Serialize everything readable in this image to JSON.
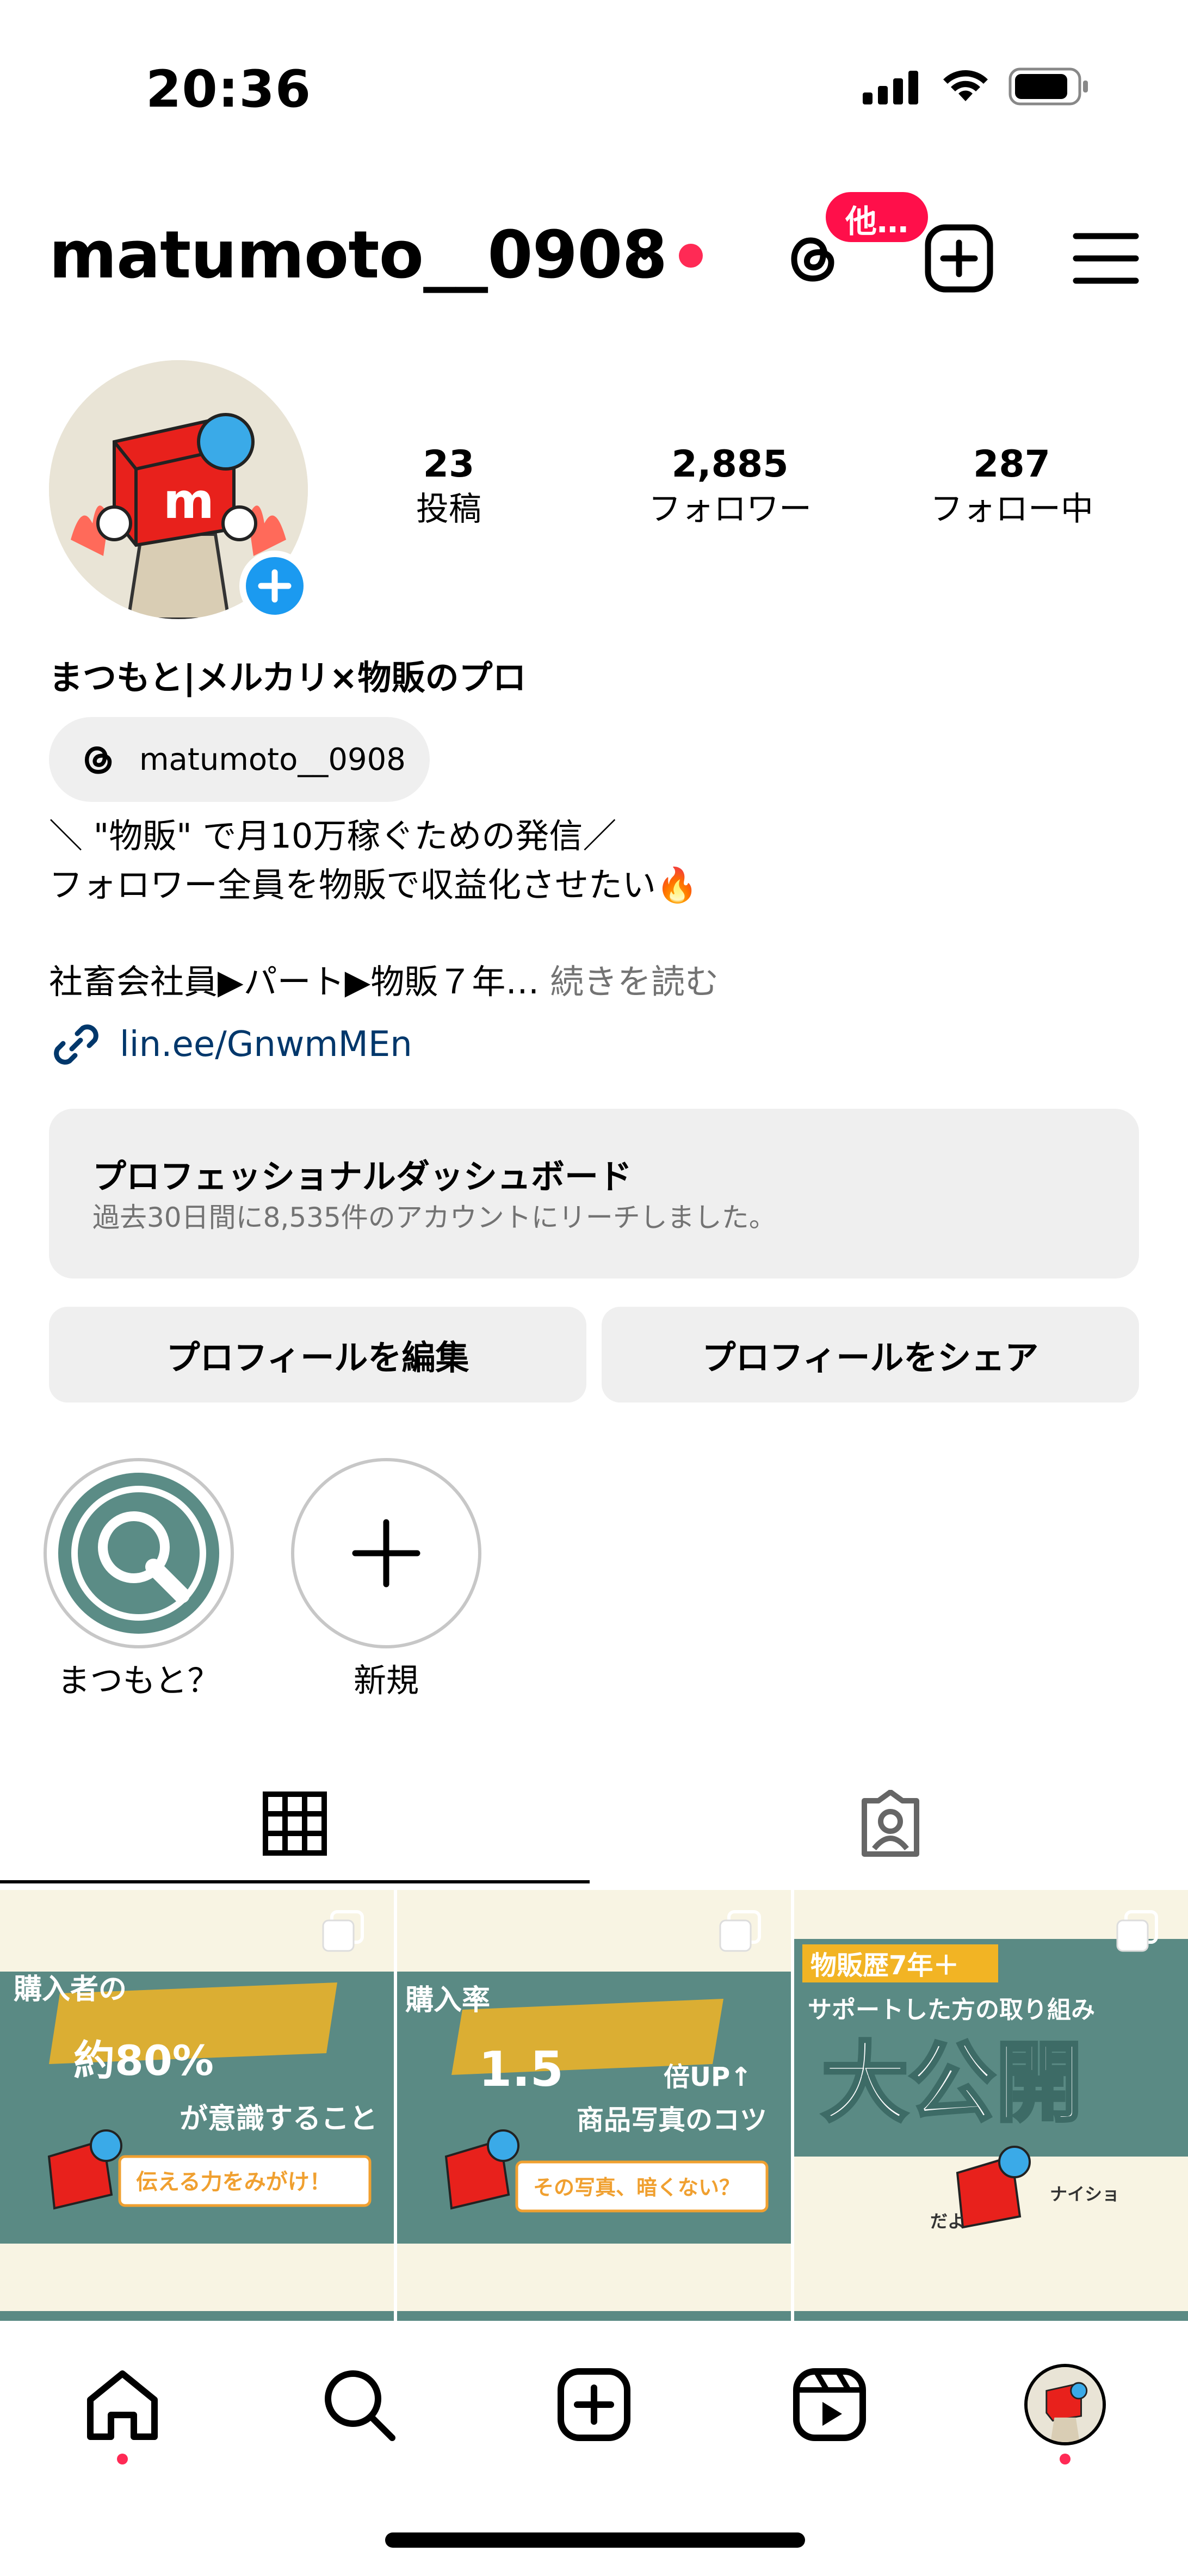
{
  "status_bar": {
    "time": "20:36"
  },
  "header": {
    "username": "matumoto__0908",
    "threads_badge": "他…"
  },
  "profile": {
    "stats": [
      {
        "value": "23",
        "label": "投稿"
      },
      {
        "value": "2,885",
        "label": "フォロワー"
      },
      {
        "value": "287",
        "label": "フォロー中"
      }
    ],
    "display_name": "まつもと|メルカリ×物販のプロ",
    "threads_handle": "matumoto__0908",
    "bio_lines": [
      "＼ \"物販\" で月10万稼ぐための発信／",
      "フォロワー全員を物販で収益化させたい🔥",
      "社畜会社員▶パート▶物販７年…"
    ],
    "more_label": "続きを読む",
    "link": "lin.ee/GnwmMEn"
  },
  "dashboard": {
    "title": "プロフェッショナルダッシュボード",
    "subtitle": "過去30日間に8,535件のアカウントにリーチしました。"
  },
  "actions": {
    "edit_label": "プロフィールを編集",
    "share_label": "プロフィールをシェア"
  },
  "highlights": [
    {
      "label": "まつもと？"
    },
    {
      "label": "新規"
    }
  ],
  "posts": [
    {
      "lines": [
        "購入者の",
        "約80%",
        "が意識すること",
        "伝える力をみがけ！"
      ]
    },
    {
      "lines": [
        "購入率",
        "1.5",
        "倍UP↑",
        "商品写真のコツ",
        "その写真、暗くない？"
      ]
    },
    {
      "lines": [
        "物販歴7年＋",
        "サポートした方の取り組み",
        "大公開",
        "ナイショ",
        "だよ"
      ]
    }
  ],
  "colors": {
    "accent_red": "#ff2a55",
    "link_blue": "#00376b",
    "add_blue": "#1b9af0",
    "post_teal": "#5a8a84",
    "post_cream": "#f8f4e3",
    "post_gold": "#f2b424"
  }
}
